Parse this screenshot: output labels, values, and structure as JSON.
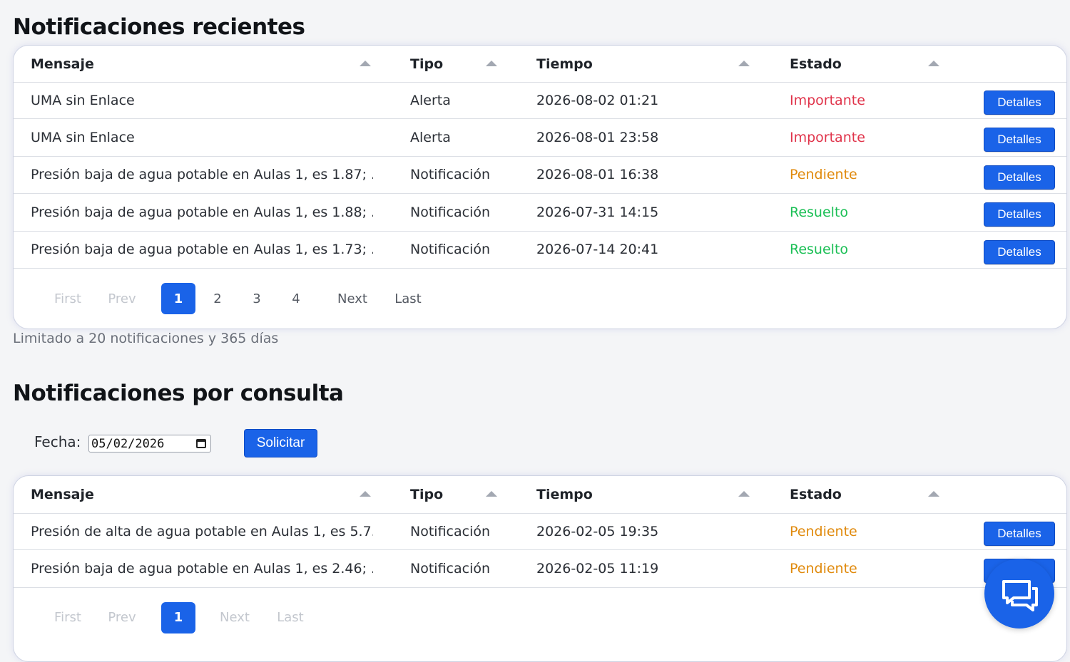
{
  "recent": {
    "title": "Notificaciones recientes",
    "columns": [
      "Mensaje",
      "Tipo",
      "Tiempo",
      "Estado"
    ],
    "rows": [
      {
        "mensaje": "UMA sin Enlace",
        "tipo": "Alerta",
        "tiempo": "2026-08-02 01:21",
        "estado": "Importante",
        "status": "important",
        "action": "Detalles"
      },
      {
        "mensaje": "UMA sin Enlace",
        "tipo": "Alerta",
        "tiempo": "2026-08-01 23:58",
        "estado": "Importante",
        "status": "important",
        "action": "Detalles"
      },
      {
        "mensaje": "Presión baja de agua potable en Aulas 1, es 1.87; ...",
        "tipo": "Notificación",
        "tiempo": "2026-08-01 16:38",
        "estado": "Pendiente",
        "status": "pending",
        "action": "Detalles"
      },
      {
        "mensaje": "Presión baja de agua potable en Aulas 1, es 1.88; ...",
        "tipo": "Notificación",
        "tiempo": "2026-07-31 14:15",
        "estado": "Resuelto",
        "status": "solved",
        "action": "Detalles"
      },
      {
        "mensaje": "Presión baja de agua potable en Aulas 1, es 1.73; ...",
        "tipo": "Notificación",
        "tiempo": "2026-07-14 20:41",
        "estado": "Resuelto",
        "status": "solved",
        "action": "Detalles"
      }
    ],
    "pagination": {
      "first": "First",
      "prev": "Prev",
      "pages": [
        "1",
        "2",
        "3",
        "4"
      ],
      "active": "1",
      "next": "Next",
      "last": "Last",
      "first_enabled": false,
      "prev_enabled": false,
      "next_enabled": true,
      "last_enabled": true
    },
    "note": "Limitado a 20 notificaciones y 365 días"
  },
  "query": {
    "title": "Notificaciones por consulta",
    "fecha_label": "Fecha:",
    "fecha_value": "05/02/2026",
    "submit_label": "Solicitar",
    "columns": [
      "Mensaje",
      "Tipo",
      "Tiempo",
      "Estado"
    ],
    "rows": [
      {
        "mensaje": "Presión de alta de agua potable en Aulas 1, es 5.7...",
        "tipo": "Notificación",
        "tiempo": "2026-02-05 19:35",
        "estado": "Pendiente",
        "status": "pending",
        "action": "Detalles"
      },
      {
        "mensaje": "Presión baja de agua potable en Aulas 1, es 2.46; ...",
        "tipo": "Notificación",
        "tiempo": "2026-02-05 11:19",
        "estado": "Pendiente",
        "status": "pending",
        "action": "Detalles"
      }
    ],
    "pagination": {
      "first": "First",
      "prev": "Prev",
      "pages": [
        "1"
      ],
      "active": "1",
      "next": "Next",
      "last": "Last",
      "first_enabled": false,
      "prev_enabled": false,
      "next_enabled": false,
      "last_enabled": false
    }
  },
  "chat": {
    "icon": "chat-bubbles-icon"
  },
  "colors": {
    "accent": "#1a63e8",
    "important": "#e0334a",
    "pending": "#e08a0d",
    "solved": "#1bbf55"
  }
}
